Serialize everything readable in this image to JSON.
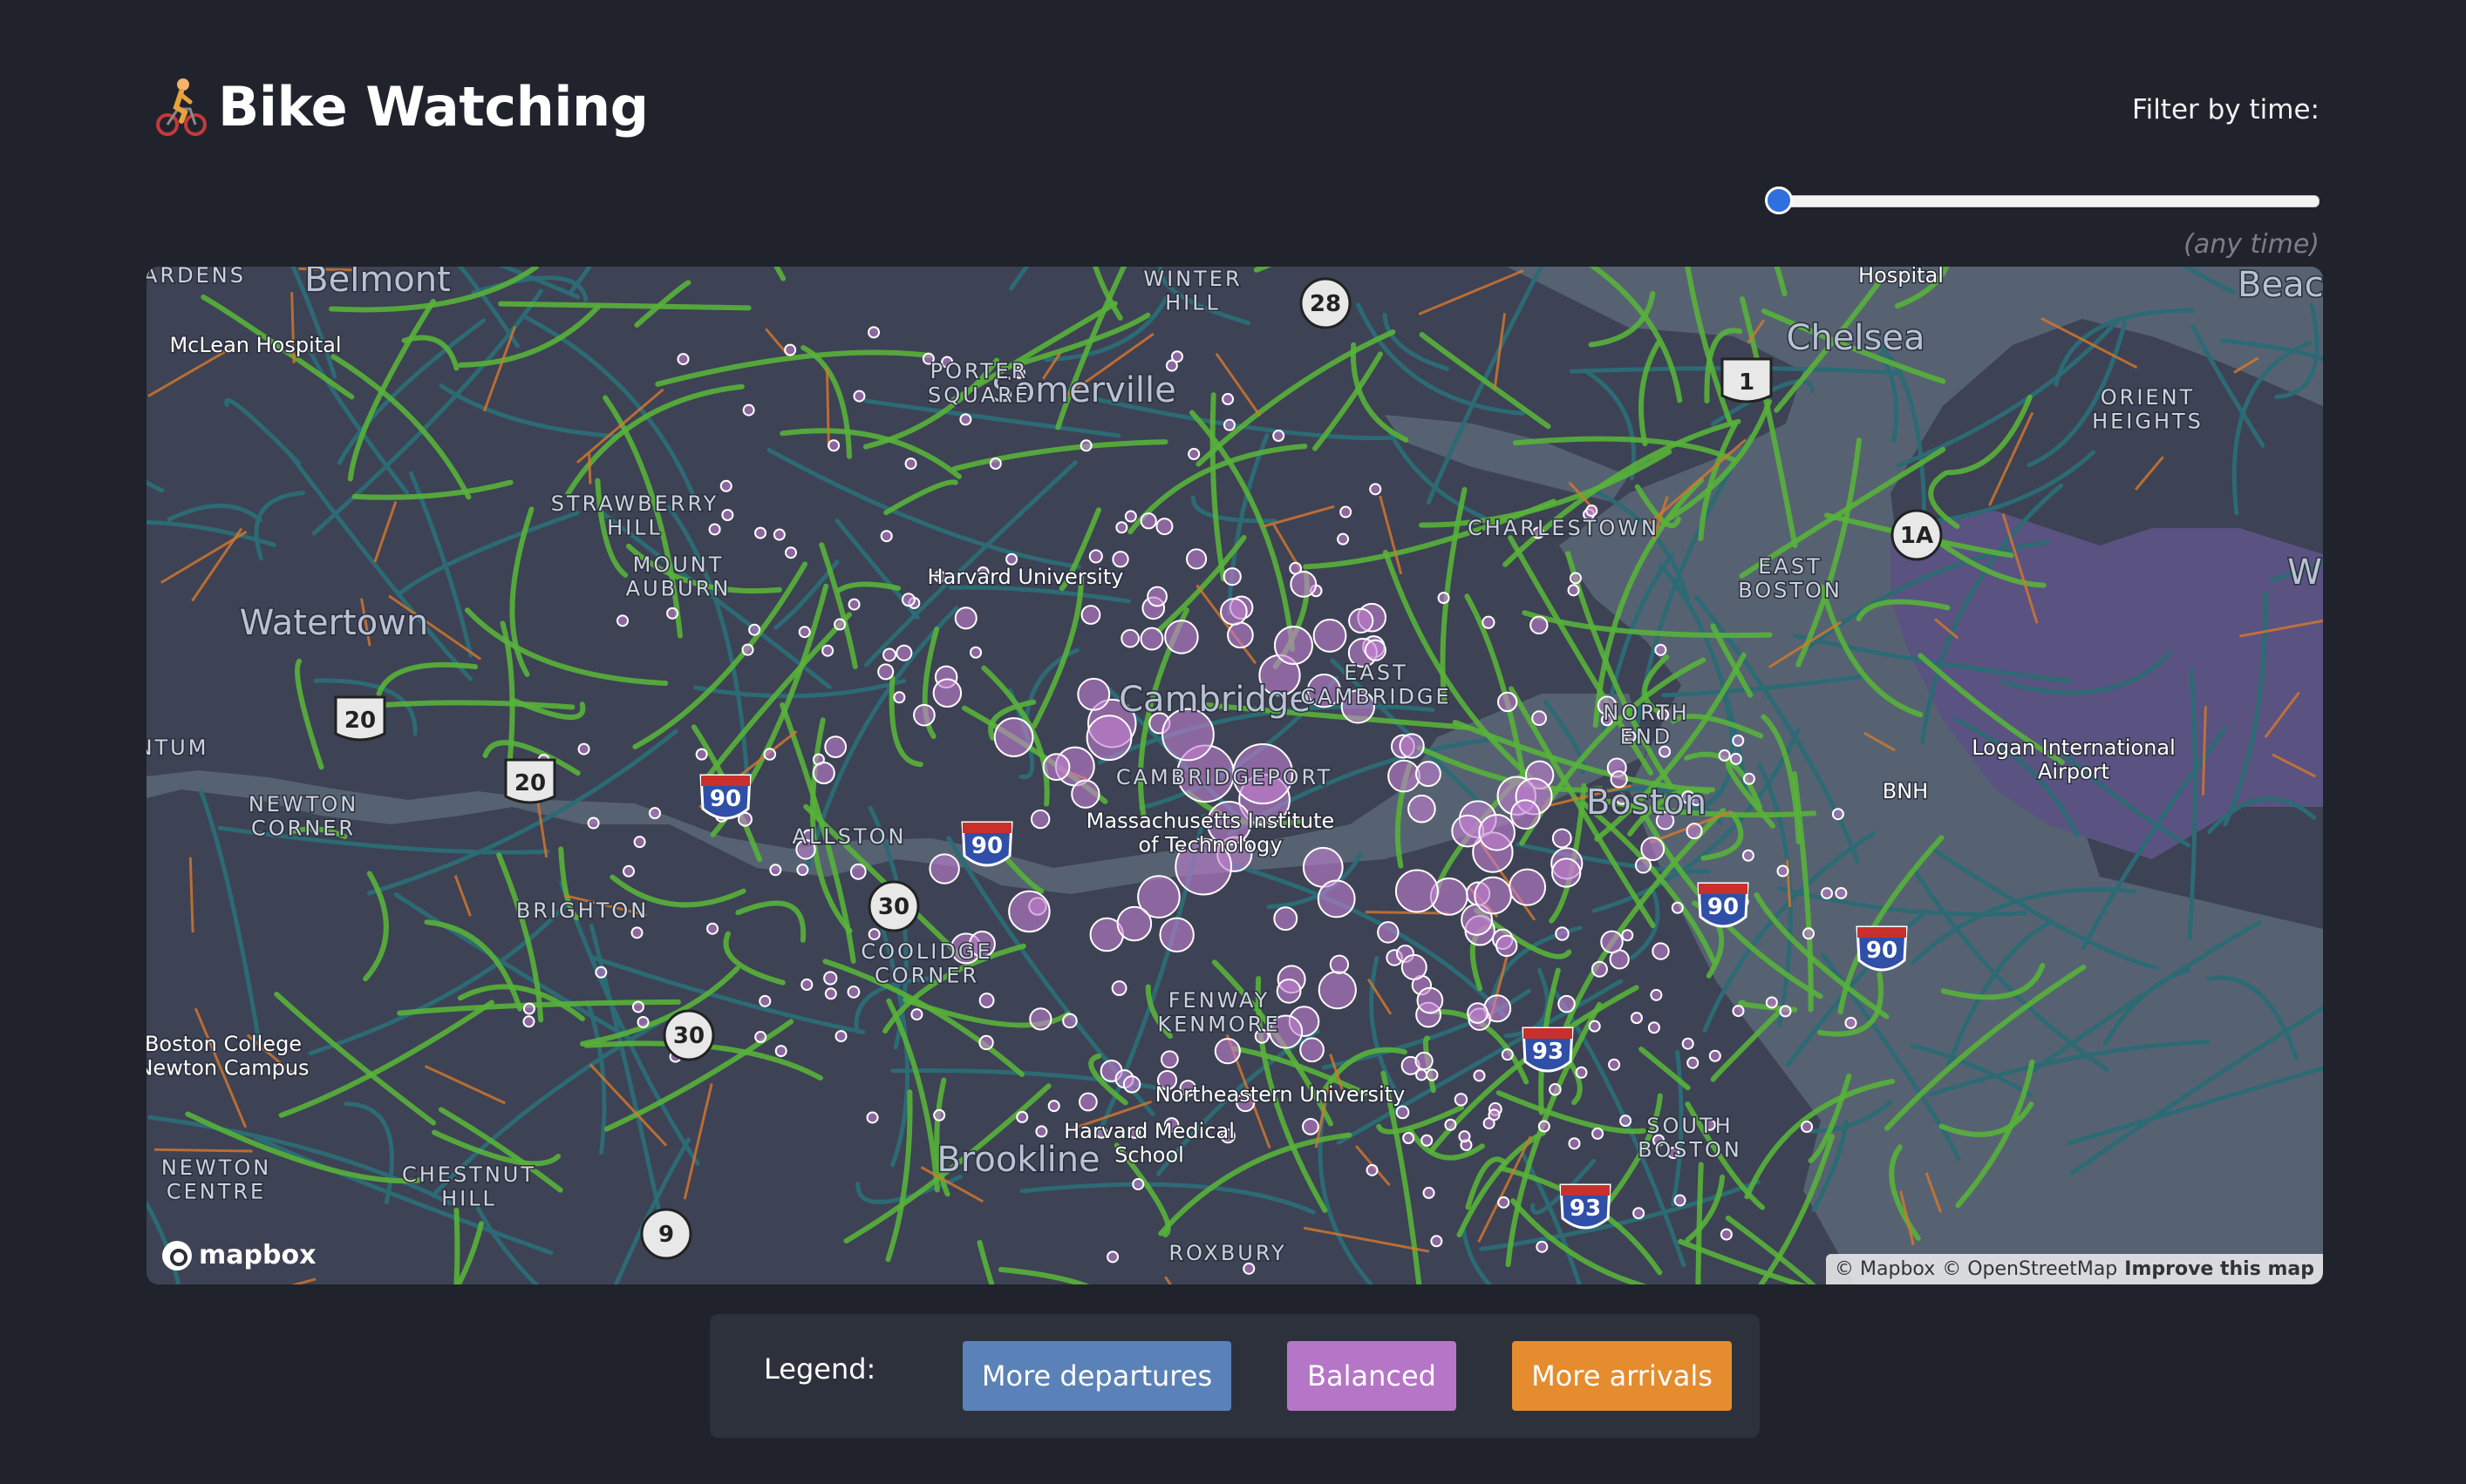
{
  "header": {
    "title_icon": "person-biking-icon",
    "title": "Bike Watching"
  },
  "filter": {
    "label": "Filter by time:",
    "slider_value": 0,
    "slider_min": -1,
    "slider_max": 1440,
    "value_text": "(any time)"
  },
  "map": {
    "place_labels": [
      {
        "text": "Belmont",
        "size": "city"
      },
      {
        "text": "Somerville",
        "size": "city"
      },
      {
        "text": "Chelsea",
        "size": "city"
      },
      {
        "text": "Watertown",
        "size": "city"
      },
      {
        "text": "Cambridge",
        "size": "city"
      },
      {
        "text": "Boston",
        "size": "city"
      },
      {
        "text": "Brookline",
        "size": "city"
      },
      {
        "text": "McLean Hospital",
        "size": "poi"
      },
      {
        "text": "Harvard University",
        "size": "poi"
      },
      {
        "text": "Massachusetts Institute of Technology",
        "size": "poi"
      },
      {
        "text": "Northeastern University",
        "size": "poi"
      },
      {
        "text": "Harvard Medical School",
        "size": "poi"
      },
      {
        "text": "Boston College Newton Campus",
        "size": "poi"
      },
      {
        "text": "Logan International Airport",
        "size": "poi"
      },
      {
        "text": "BNH",
        "size": "poi"
      },
      {
        "text": "Hospital",
        "size": "poi"
      },
      {
        "text": "STRAWBERRY HILL",
        "size": "hood"
      },
      {
        "text": "MOUNT AUBURN",
        "size": "hood"
      },
      {
        "text": "PORTER SQUARE",
        "size": "hood"
      },
      {
        "text": "WINTER HILL",
        "size": "hood"
      },
      {
        "text": "CHARLESTOWN",
        "size": "hood"
      },
      {
        "text": "EAST BOSTON",
        "size": "hood"
      },
      {
        "text": "ORIENT HEIGHTS",
        "size": "hood"
      },
      {
        "text": "NORTH END",
        "size": "hood"
      },
      {
        "text": "EAST CAMBRIDGE",
        "size": "hood"
      },
      {
        "text": "CAMBRIDGEPORT",
        "size": "hood"
      },
      {
        "text": "ALLSTON",
        "size": "hood"
      },
      {
        "text": "BRIGHTON",
        "size": "hood"
      },
      {
        "text": "NEWTON CORNER",
        "size": "hood"
      },
      {
        "text": "COOLIDGE CORNER",
        "size": "hood"
      },
      {
        "text": "FENWAY KENMORE",
        "size": "hood"
      },
      {
        "text": "SOUTH BOSTON",
        "size": "hood"
      },
      {
        "text": "NEWTON CENTRE",
        "size": "hood"
      },
      {
        "text": "CHESTNUT HILL",
        "size": "hood"
      },
      {
        "text": "ROXBURY",
        "size": "hood"
      },
      {
        "text": "ARDENS",
        "size": "hood"
      },
      {
        "text": "NTUM",
        "size": "hood"
      },
      {
        "text": "Beach",
        "size": "city"
      },
      {
        "text": "W",
        "size": "city"
      }
    ],
    "route_shields": [
      {
        "text": "28",
        "kind": "state"
      },
      {
        "text": "1",
        "kind": "us"
      },
      {
        "text": "1A",
        "kind": "state"
      },
      {
        "text": "20",
        "kind": "us"
      },
      {
        "text": "20",
        "kind": "us"
      },
      {
        "text": "90",
        "kind": "interstate"
      },
      {
        "text": "90",
        "kind": "interstate"
      },
      {
        "text": "90",
        "kind": "interstate"
      },
      {
        "text": "90",
        "kind": "interstate"
      },
      {
        "text": "30",
        "kind": "state"
      },
      {
        "text": "30",
        "kind": "state"
      },
      {
        "text": "93",
        "kind": "interstate"
      },
      {
        "text": "93",
        "kind": "interstate"
      },
      {
        "text": "9",
        "kind": "state"
      }
    ],
    "station_color": "#c17fd0",
    "logo_text": "mapbox",
    "attribution": [
      "© Mapbox",
      "© OpenStreetMap"
    ],
    "improve_link": "Improve this map"
  },
  "legend": {
    "label": "Legend:",
    "items": [
      {
        "label": "More departures",
        "color": "#5b82b8"
      },
      {
        "label": "Balanced",
        "color": "#b676c8"
      },
      {
        "label": "More arrivals",
        "color": "#e58c2e"
      }
    ]
  }
}
